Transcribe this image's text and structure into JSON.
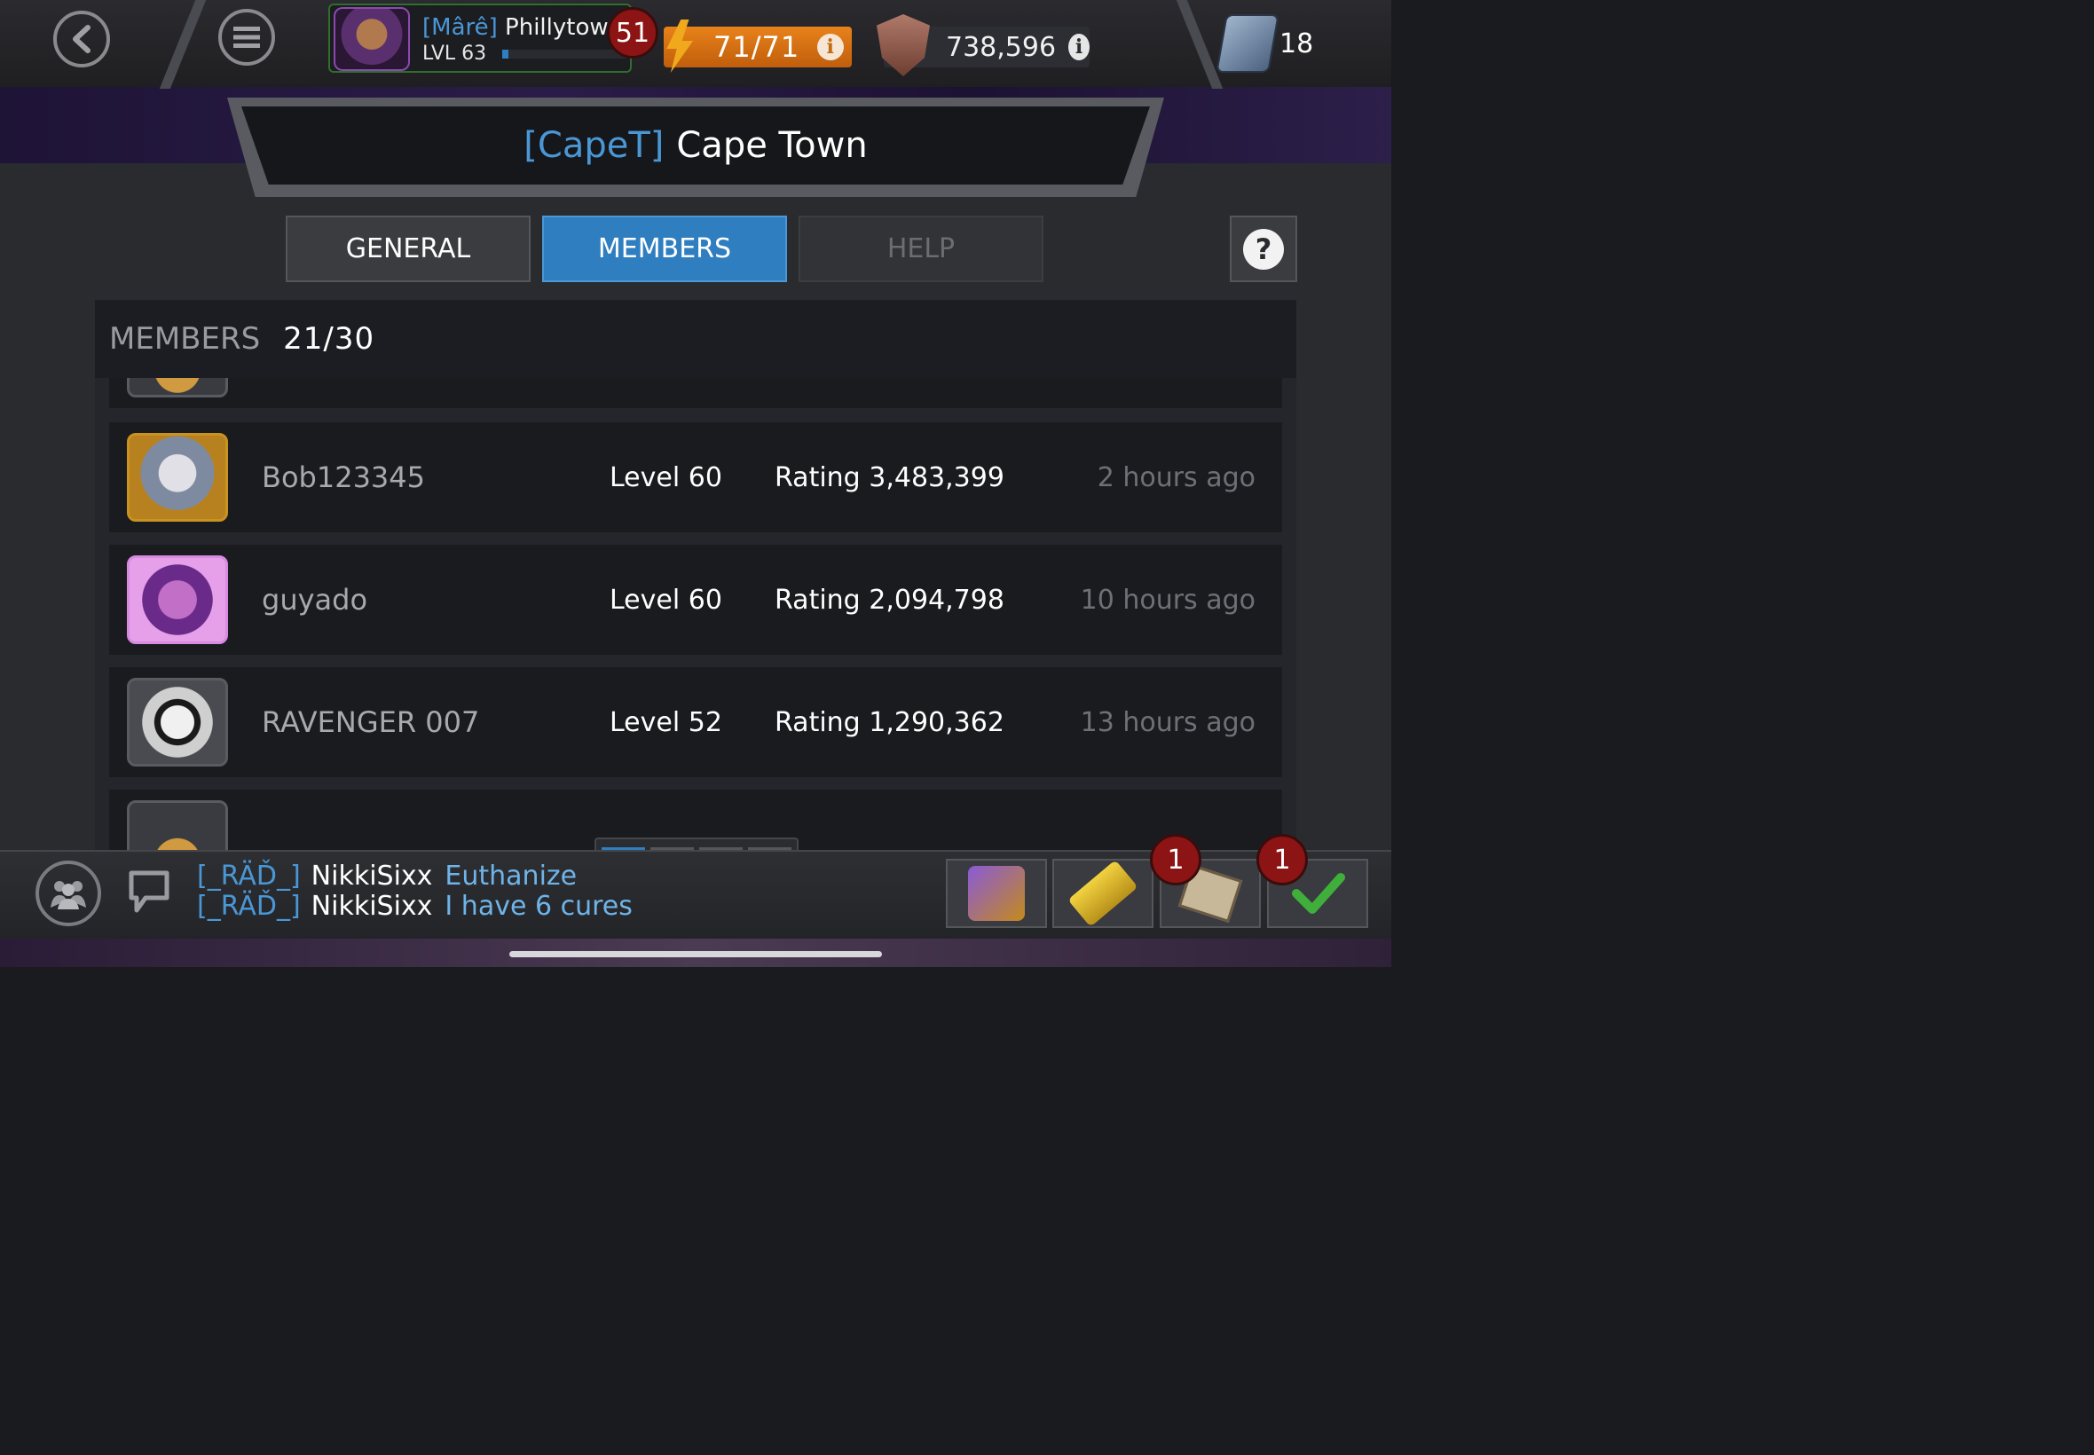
{
  "header": {
    "player": {
      "alliance_tag": "[Mârê]",
      "name": "Phillytown",
      "level": "LVL 63",
      "level_badge": "51"
    },
    "energy": "71/71",
    "rating": "738,596",
    "units": "18",
    "info_glyph": "i"
  },
  "alliance": {
    "tag": "[CapeT]",
    "name": "Cape Town"
  },
  "tabs": {
    "general": "GENERAL",
    "members": "MEMBERS",
    "help": "HELP",
    "active": "members",
    "help_glyph": "?"
  },
  "members": {
    "label": "MEMBERS",
    "count": "21/30",
    "rows": [
      {
        "name": "Bob123345",
        "level": "Level 60",
        "rating": "Rating 3,483,399",
        "last_seen": "2 hours ago",
        "portrait": "thor-portrait-icon"
      },
      {
        "name": "guyado",
        "level": "Level 60",
        "rating": "Rating 2,094,798",
        "last_seen": "10 hours ago",
        "portrait": "psylocke-portrait-icon"
      },
      {
        "name": "RAVENGER 007",
        "level": "Level 52",
        "rating": "Rating 1,290,362",
        "last_seen": "13 hours ago",
        "portrait": "moon-knight-portrait-icon"
      }
    ]
  },
  "scroll_pages": {
    "count": 4,
    "active": 1
  },
  "chat": [
    {
      "tag": "[_RÄĎ_]",
      "user": "NikkiSixx",
      "message": "Euthanize"
    },
    {
      "tag": "[_RÄĎ_]",
      "user": "NikkiSixx",
      "message": "I have 6 cures"
    }
  ],
  "notifications": {
    "quests": "1",
    "achievements": "1"
  },
  "colors": {
    "accent_blue": "#2f7ec0",
    "energy_orange": "#e8821a",
    "badge_red": "#8c1414",
    "online_green": "#2f6e2c"
  }
}
